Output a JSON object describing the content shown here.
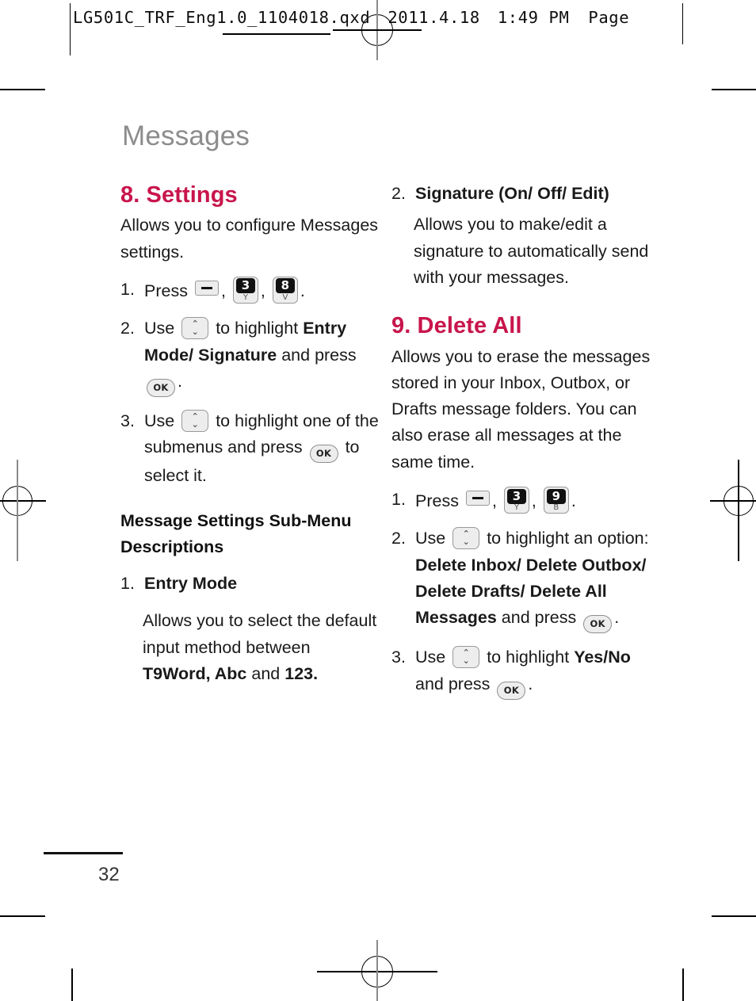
{
  "prepress": {
    "slug_file": "LG501C_TRF_Eng1.0_1104018.qxd",
    "slug_date": "2011.4.18",
    "slug_time": "1:49 PM",
    "slug_page": "Page"
  },
  "chapter": {
    "title": "Messages"
  },
  "left_column": {
    "section": {
      "heading": "8. Settings",
      "intro": "Allows you to configure Messages settings."
    },
    "steps": [
      {
        "num": "1.",
        "pre": "Press",
        "keys": [
          "key-menu",
          "key-3-Y",
          "key-8-V"
        ],
        "post": "."
      },
      {
        "num": "2.",
        "pre": "Use",
        "key": "key-nav",
        "mid": "to highlight",
        "bold": "Entry Mode/ Signature",
        "tail": "and press",
        "ok": "OK",
        "end": "."
      },
      {
        "num": "3.",
        "pre": "Use",
        "key": "key-nav",
        "mid": "to highlight one of the submenus and press",
        "ok": "OK",
        "tail": "to select it."
      }
    ],
    "subhead": "Message Settings Sub-Menu Descriptions",
    "submenu": {
      "num": "1.",
      "title": "Entry Mode",
      "desc_pre": "Allows you to select the default input method between",
      "desc_bold1": "T9Word, Abc",
      "desc_mid": "and",
      "desc_bold2": "123."
    }
  },
  "right_column": {
    "signature": {
      "num": "2.",
      "title": "Signature (On/ Off/ Edit)",
      "desc": "Allows you to make/edit a signature to automatically send with your messages."
    },
    "section": {
      "heading": "9. Delete All",
      "intro": "Allows you to erase the messages stored in your Inbox, Outbox, or Drafts message folders. You can also erase all messages at the same time."
    },
    "steps": [
      {
        "num": "1.",
        "pre": "Press",
        "keys": [
          "key-menu",
          "key-3-Y",
          "key-9-B"
        ],
        "post": "."
      },
      {
        "num": "2.",
        "pre": "Use",
        "key": "key-nav",
        "mid": "to highlight an option:",
        "bold": "Delete Inbox/ Delete Outbox/ Delete Drafts/ Delete All Messages",
        "tail": "and press",
        "ok": "OK",
        "end": "."
      },
      {
        "num": "3.",
        "pre": "Use",
        "key": "key-nav",
        "mid": "to highlight",
        "bold1": "Yes/",
        "bold2": "No",
        "tail": "and press",
        "ok": "OK",
        "end": "."
      }
    ]
  },
  "keys": {
    "menu": {
      "label": "",
      "type": "soft-minus"
    },
    "k3": {
      "digit": "3",
      "letter": "Y"
    },
    "k8": {
      "digit": "8",
      "letter": "V"
    },
    "k9": {
      "digit": "9",
      "letter": "B"
    },
    "nav": {
      "up": "⌃",
      "down": "⌄"
    },
    "ok": {
      "label": "OK"
    }
  },
  "footer": {
    "page_number": "32"
  },
  "colors": {
    "heading": "#C8154C",
    "chapter": "#8C8C8C",
    "text": "#1A1A1A"
  }
}
